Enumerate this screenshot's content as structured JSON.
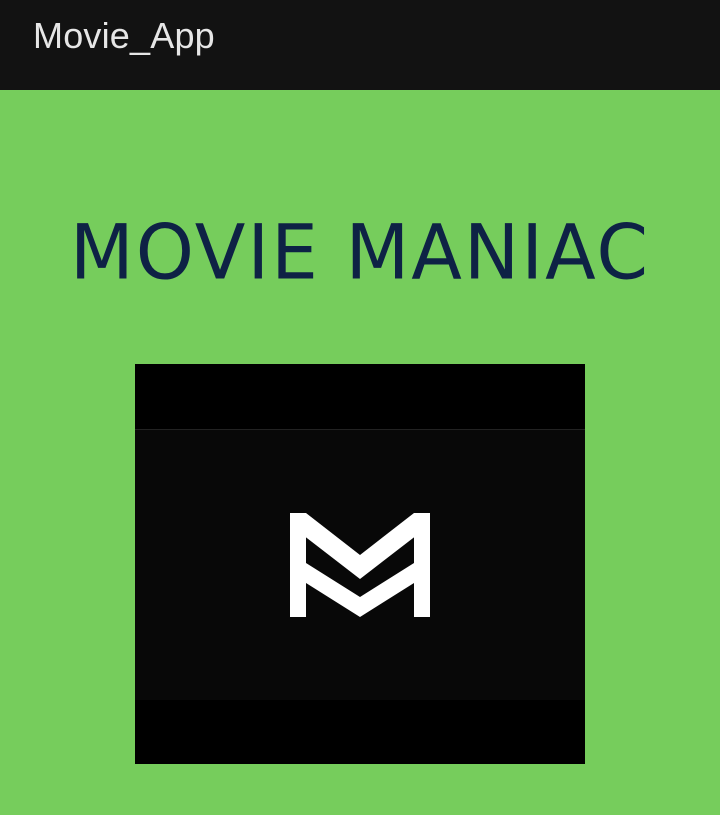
{
  "app_bar": {
    "title": "Movie_App"
  },
  "main": {
    "headline": "MOVIE MANIAC",
    "logo": {
      "icon": "movie-maniac-m-logo-icon",
      "colors": {
        "mark": "#ffffff",
        "background": "#000000"
      }
    }
  },
  "colors": {
    "app_bar": "#121212",
    "background": "#76cd5c",
    "headline": "#0e2245"
  }
}
